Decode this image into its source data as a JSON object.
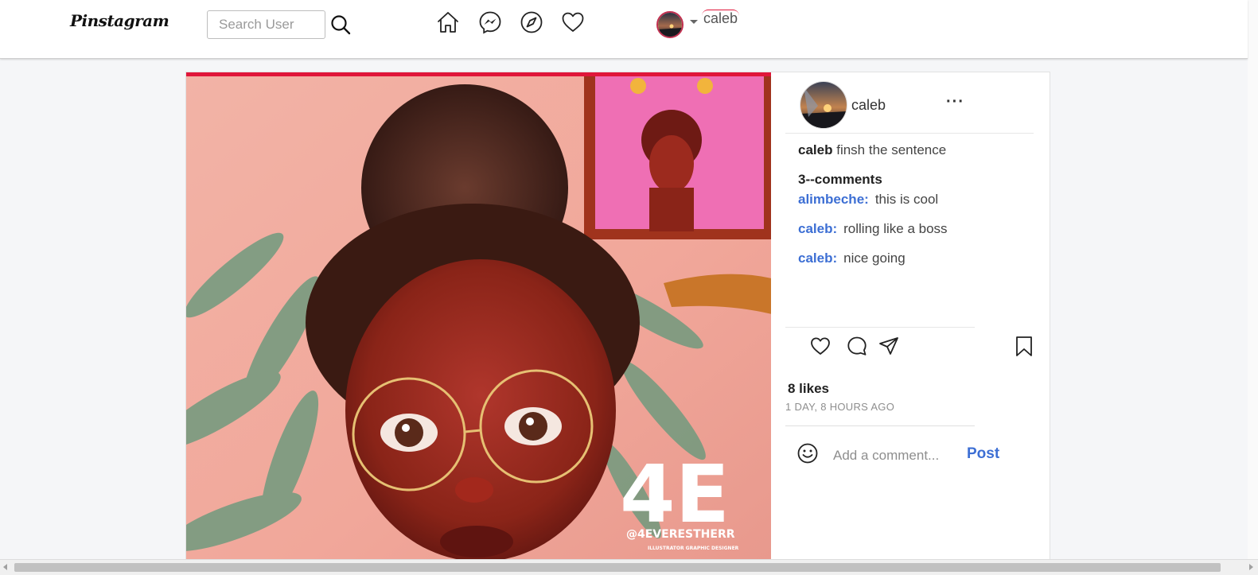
{
  "header": {
    "logo_text": "Pinstagram",
    "search_placeholder": "Search User",
    "nav_icons": [
      "home-icon",
      "messenger-icon",
      "explore-icon",
      "heart-icon"
    ],
    "username": "caleb"
  },
  "post": {
    "author": "caleb",
    "image_watermark": "4E",
    "image_credit": "@4EVERESTHERR",
    "image_credit_sub": "ILLUSTRATOR GRAPHIC DESIGNER",
    "caption_user": "caleb",
    "caption_text": "finsh the sentence",
    "comments_label": "3--comments",
    "comments": [
      {
        "user": "alimbeche:",
        "text": "this is cool"
      },
      {
        "user": "caleb:",
        "text": "rolling like a boss"
      },
      {
        "user": "caleb:",
        "text": "nice going"
      }
    ],
    "likes": "8 likes",
    "time_ago": "1 DAY, 8 HOURS AGO",
    "comment_placeholder": "Add a comment...",
    "post_button": "Post"
  },
  "colors": {
    "accent_red": "#e0163a",
    "link_blue": "#3d6fd4"
  }
}
